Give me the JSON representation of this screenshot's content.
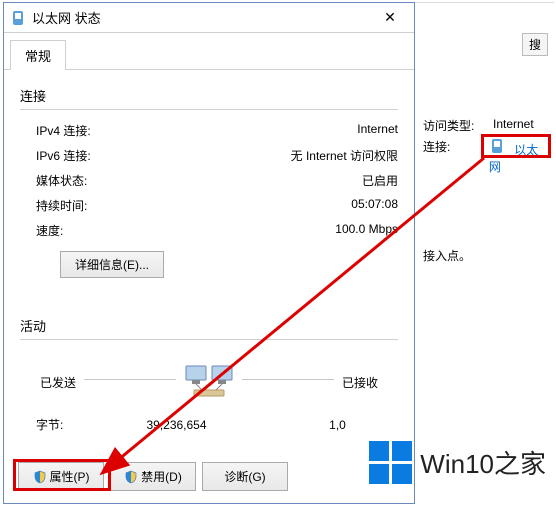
{
  "dialog": {
    "title": "以太网 状态",
    "tab_general": "常规",
    "section_connection": "连接",
    "ipv4_label": "IPv4 连接:",
    "ipv4_value": "Internet",
    "ipv6_label": "IPv6 连接:",
    "ipv6_value": "无 Internet 访问权限",
    "media_label": "媒体状态:",
    "media_value": "已启用",
    "duration_label": "持续时间:",
    "duration_value": "05:07:08",
    "speed_label": "速度:",
    "speed_value": "100.0 Mbps",
    "details_btn": "详细信息(E)...",
    "section_activity": "活动",
    "sent_label": "已发送",
    "received_label": "已接收",
    "bytes_label": "字节:",
    "bytes_sent": "39,236,654",
    "bytes_received": "1,0",
    "btn_properties": "属性(P)",
    "btn_disable": "禁用(D)",
    "btn_diagnose": "诊断(G)"
  },
  "right": {
    "search_btn": "搜",
    "access_type_label": "访问类型:",
    "access_type_value": "Internet",
    "connections_label": "连接:",
    "connections_value": "以太网",
    "ap_text": "接入点。"
  },
  "logo": {
    "text": "Win10之家"
  }
}
